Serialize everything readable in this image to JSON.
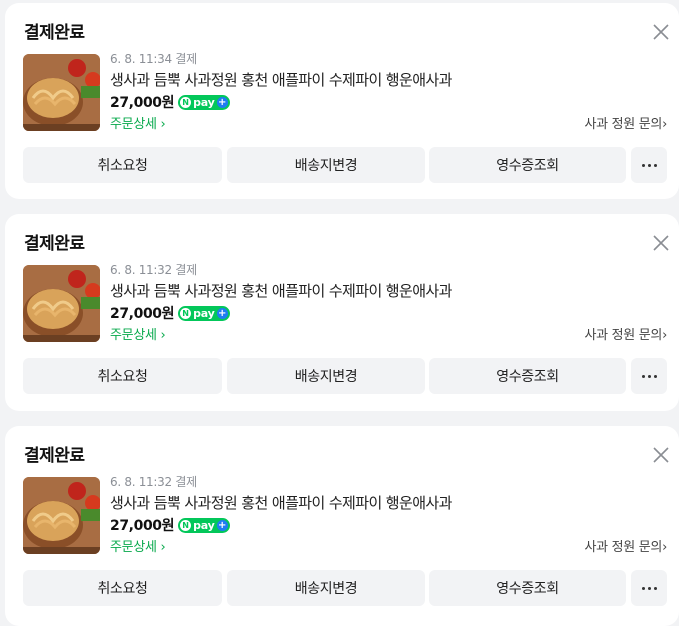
{
  "orders": [
    {
      "status": "결제완료",
      "date": "6. 8. 11:34 결제",
      "product_name": "생사과 듬뿍 사과정원 홍천 애플파이 수제파이 행운애사과",
      "price": "27,000원",
      "pay_badge": "pay",
      "detail_link": "주문상세",
      "inquiry_link": "사과 정원 문의",
      "actions": [
        "취소요청",
        "배송지변경",
        "영수증조회"
      ]
    },
    {
      "status": "결제완료",
      "date": "6. 8. 11:32 결제",
      "product_name": "생사과 듬뿍 사과정원 홍천 애플파이 수제파이 행운애사과",
      "price": "27,000원",
      "pay_badge": "pay",
      "detail_link": "주문상세",
      "inquiry_link": "사과 정원 문의",
      "actions": [
        "취소요청",
        "배송지변경",
        "영수증조회"
      ]
    },
    {
      "status": "결제완료",
      "date": "6. 8. 11:32 결제",
      "product_name": "생사과 듬뿍 사과정원 홍천 애플파이 수제파이 행운애사과",
      "price": "27,000원",
      "pay_badge": "pay",
      "detail_link": "주문상세",
      "inquiry_link": "사과 정원 문의",
      "actions": [
        "취소요청",
        "배송지변경",
        "영수증조회"
      ]
    }
  ],
  "icons": {
    "close": "close-icon",
    "more": "more-icon",
    "chevron": "chevron-right-icon",
    "npay": "naver-pay-icon"
  },
  "colors": {
    "accent_green": "#03c75a",
    "link_green": "#08a94c",
    "background": "#f2f3f5",
    "button_bg": "#f2f3f5"
  }
}
